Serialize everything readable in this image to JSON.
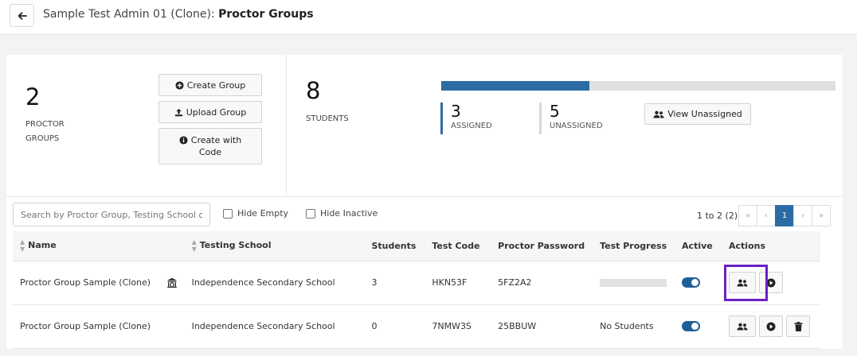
{
  "header": {
    "title_prefix": "Sample Test Admin 01 (Clone):",
    "title_main": "Proctor Groups"
  },
  "summary": {
    "group_count": "2",
    "group_label_line1": "PROCTOR",
    "group_label_line2": "GROUPS",
    "buttons": {
      "create_group": "Create Group",
      "upload_group": "Upload Group",
      "create_with_code_line1": "Create with",
      "create_with_code_line2": "Code"
    },
    "students_count": "8",
    "students_label": "STUDENTS",
    "assigned_fraction": 0.375,
    "assigned_count": "3",
    "assigned_label": "ASSIGNED",
    "unassigned_count": "5",
    "unassigned_label": "UNASSIGNED",
    "view_unassigned": "View Unassigned"
  },
  "filters": {
    "search_placeholder": "Search by Proctor Group, Testing School or Test Code",
    "hide_empty": "Hide Empty",
    "hide_inactive": "Hide Inactive"
  },
  "pagination": {
    "info": "1 to 2 (2)",
    "first": "«",
    "prev": "‹",
    "current": "1",
    "next": "›",
    "last": "»"
  },
  "table": {
    "headers": {
      "name": "Name",
      "school": "Testing School",
      "students": "Students",
      "test_code": "Test Code",
      "password": "Proctor Password",
      "progress": "Test Progress",
      "active": "Active",
      "actions": "Actions"
    },
    "rows": [
      {
        "name": "Proctor Group Sample (Clone)",
        "school": "Independence Secondary School",
        "students": "3",
        "test_code": "HKN53F",
        "password": "5FZ2A2",
        "progress": "",
        "active": true
      },
      {
        "name": "Proctor Group Sample (Clone)",
        "school": "Independence Secondary School",
        "students": "0",
        "test_code": "7NMW3S",
        "password": "25BBUW",
        "progress": "No Students",
        "active": true
      }
    ]
  },
  "colors": {
    "accent": "#2b6ca3",
    "highlight": "#6a1fc4"
  },
  "icons": [
    "back-arrow-icon",
    "plus-circle-icon",
    "upload-icon",
    "info-circle-icon",
    "users-icon",
    "school-icon",
    "play-circle-icon",
    "trash-icon",
    "sort-icon"
  ]
}
